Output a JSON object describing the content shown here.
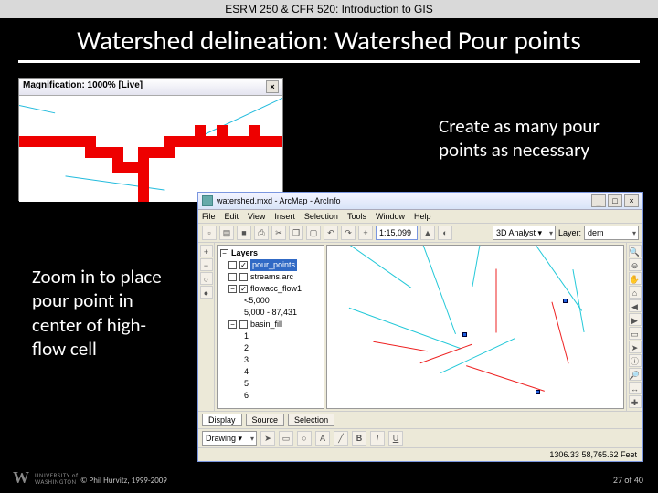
{
  "course_band": "ESRM 250 & CFR 520: Introduction to GIS",
  "slide_title": "Watershed delineation: Watershed Pour points",
  "callouts": {
    "right": "Create as many pour points as necessary",
    "left": "Zoom in to place pour point in center of high-flow cell"
  },
  "mag_panel": {
    "title": "Magnification: 1000% [Live]",
    "close": "×"
  },
  "arcmap": {
    "title": "watershed.mxd - ArcMap - ArcInfo",
    "menu": [
      "File",
      "Edit",
      "View",
      "Insert",
      "Selection",
      "Tools",
      "Window",
      "Help"
    ],
    "toolbar": {
      "scale": "1:15,099",
      "analysis_label": "3D Analyst ▾",
      "layer_label": "Layer:",
      "layer_value": "dem"
    },
    "winbtns": {
      "min": "_",
      "max": "□",
      "close": "×"
    },
    "toc": {
      "root": "Layers",
      "items": [
        {
          "checked": true,
          "label": "pour_points",
          "selected": true,
          "sym": "#2060e0"
        },
        {
          "checked": false,
          "label": "streams.arc",
          "sym": "#888"
        },
        {
          "checked": true,
          "label": "flowacc_flow1",
          "children": [
            {
              "label": "<5,000",
              "sym": "#ffffff"
            },
            {
              "label": "5,000 - 87,431",
              "sym": "#e00000"
            }
          ]
        },
        {
          "checked": false,
          "label": "basin_fill",
          "children": [
            {
              "label": "1",
              "sym": "#a0e060"
            },
            {
              "label": "2",
              "sym": "#30a060"
            },
            {
              "label": "3",
              "sym": "#3060e0"
            },
            {
              "label": "4",
              "sym": "#f08030"
            },
            {
              "label": "5",
              "sym": "#b03090"
            },
            {
              "label": "6",
              "sym": "#e0c030"
            }
          ]
        }
      ]
    },
    "bottom_tabs": [
      "Display",
      "Source",
      "Selection"
    ],
    "drawing_label": "Drawing ▾",
    "status": "1306.33  58,765.62 Feet"
  },
  "footer": {
    "copyright": "© Phil Hurvitz, 1999-2009",
    "page": "27 of 40",
    "uw_line1": "UNIVERSITY of",
    "uw_line2": "WASHINGTON"
  }
}
